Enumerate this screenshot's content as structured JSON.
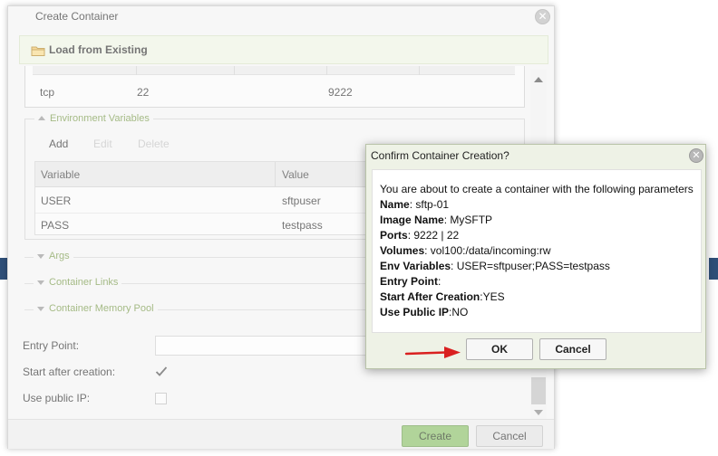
{
  "main_dialog": {
    "title": "Create Container",
    "load_label": "Load from Existing",
    "ports_row": {
      "protocol": "tcp",
      "container_port": "22",
      "host_port": "9222"
    },
    "env": {
      "legend": "Environment Variables",
      "actions": {
        "add": "Add",
        "edit": "Edit",
        "delete": "Delete"
      },
      "columns": {
        "variable": "Variable",
        "value": "Value"
      },
      "rows": [
        {
          "variable": "USER",
          "value": "sftpuser"
        },
        {
          "variable": "PASS",
          "value": "testpass"
        }
      ]
    },
    "sections": {
      "args": "Args",
      "links": "Container Links",
      "memory": "Container Memory Pool"
    },
    "form": {
      "entry_point_label": "Entry Point:",
      "start_after_label": "Start after creation:",
      "start_after_checked": true,
      "public_ip_label": "Use public IP:",
      "public_ip_checked": false
    },
    "buttons": {
      "create": "Create",
      "cancel": "Cancel"
    }
  },
  "confirm_dialog": {
    "title": "Confirm Container Creation?",
    "intro": "You are about to create a container with the following parameters",
    "params": [
      {
        "label": "Name",
        "sep": ": ",
        "value": "sftp-01"
      },
      {
        "label": "Image Name",
        "sep": ": ",
        "value": "MySFTP"
      },
      {
        "label": "Ports",
        "sep": ": ",
        "value": "9222 | 22"
      },
      {
        "label": "Volumes",
        "sep": ": ",
        "value": "vol100:/data/incoming:rw"
      },
      {
        "label": "Env Variables",
        "sep": ": ",
        "value": "USER=sftpuser;PASS=testpass"
      },
      {
        "label": "Entry Point",
        "sep": ":",
        "value": ""
      },
      {
        "label": "Start After Creation",
        "sep": ":",
        "value": "YES"
      },
      {
        "label": "Use Public IP",
        "sep": ":",
        "value": "NO"
      }
    ],
    "buttons": {
      "ok": "OK",
      "cancel": "Cancel"
    }
  },
  "colors": {
    "accent_green": "#8cc06b",
    "legend_green": "#7a9a4c",
    "arrow_red": "#d92020",
    "side_strip_blue": "#2f4f78"
  }
}
